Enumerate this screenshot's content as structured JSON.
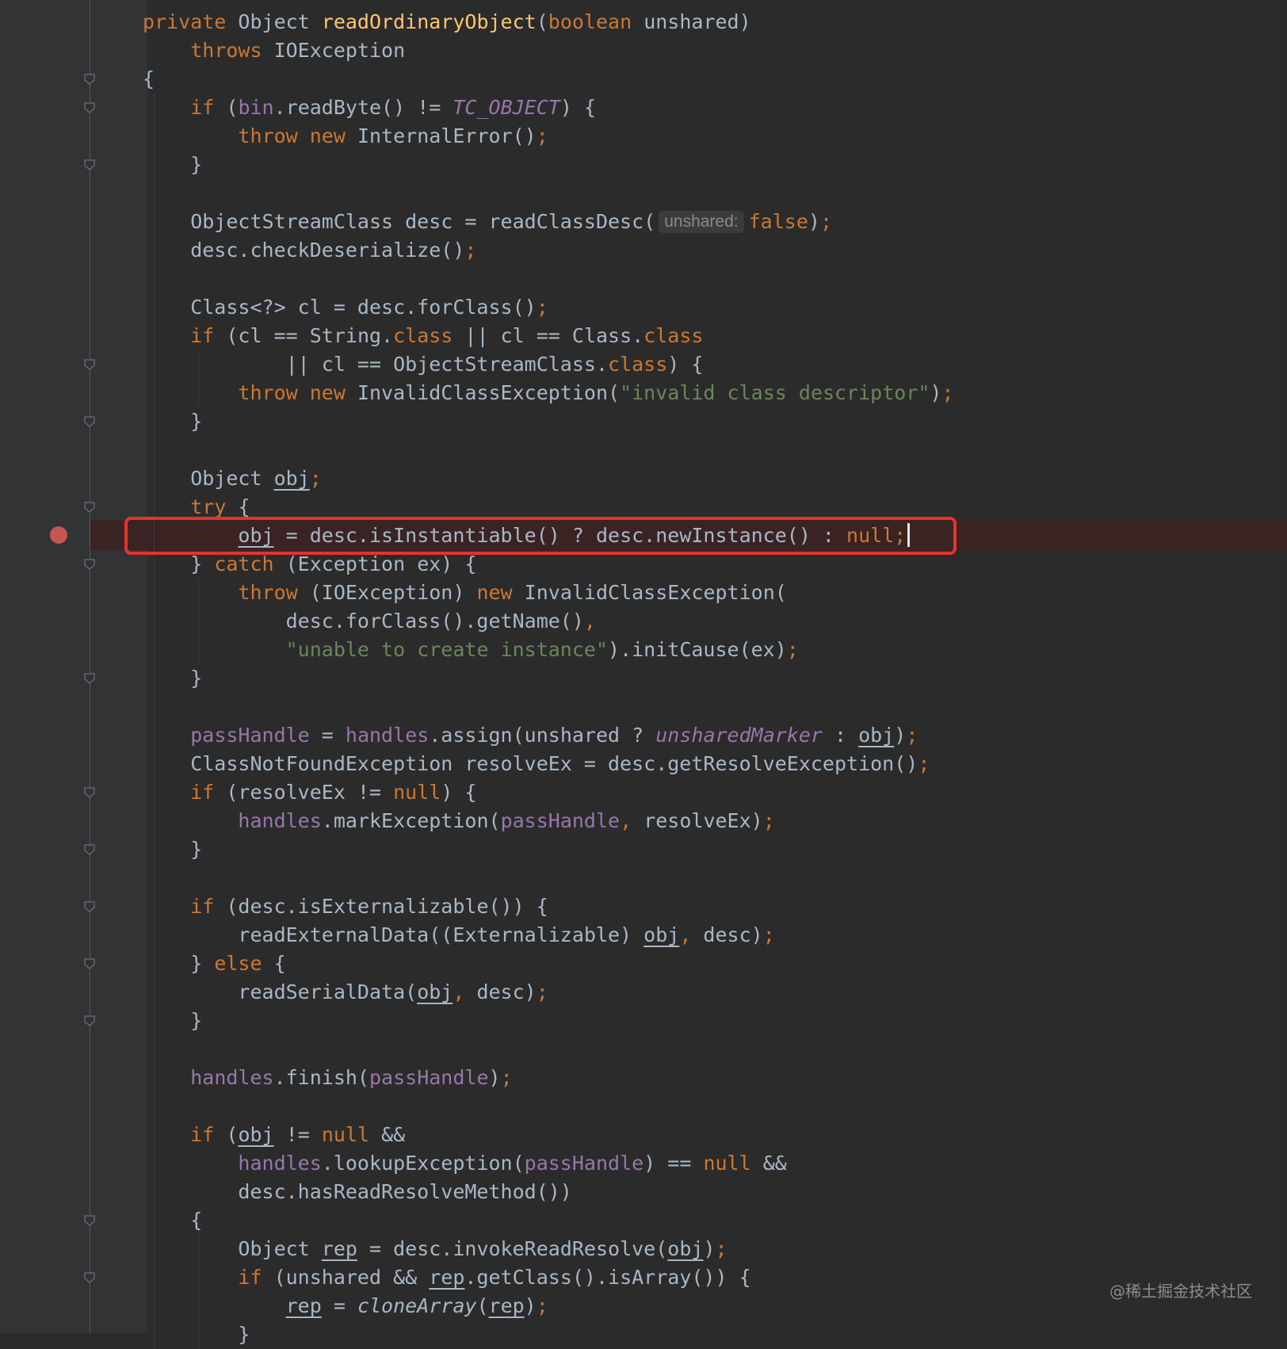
{
  "editor": {
    "language": "Java",
    "highlighted_line": 19,
    "breakpoint_line": 19,
    "lines": [
      [
        {
          "t": "private ",
          "c": "kw"
        },
        {
          "t": "Object "
        },
        {
          "t": "readOrdinaryObject",
          "c": "fn"
        },
        {
          "t": "("
        },
        {
          "t": "boolean ",
          "c": "kw"
        },
        {
          "t": "unshared)"
        }
      ],
      [
        {
          "t": "    "
        },
        {
          "t": "throws ",
          "c": "kw"
        },
        {
          "t": "IOException"
        }
      ],
      [
        {
          "t": "{"
        }
      ],
      [
        {
          "t": "    "
        },
        {
          "t": "if ",
          "c": "kw"
        },
        {
          "t": "("
        },
        {
          "t": "bin",
          "c": "fld"
        },
        {
          "t": ".readByte() != "
        },
        {
          "t": "TC_OBJECT",
          "c": "ist"
        },
        {
          "t": ") {"
        }
      ],
      [
        {
          "t": "        "
        },
        {
          "t": "throw new ",
          "c": "kw"
        },
        {
          "t": "InternalError()"
        },
        {
          "t": ";",
          "c": "kw"
        }
      ],
      [
        {
          "t": "    }"
        }
      ],
      [],
      [
        {
          "t": "    ObjectStreamClass desc = readClassDesc("
        },
        {
          "t": "unshared:",
          "c": "hint"
        },
        {
          "t": "false",
          "c": "kw"
        },
        {
          "t": ")"
        },
        {
          "t": ";",
          "c": "kw"
        }
      ],
      [
        {
          "t": "    desc.checkDeserialize()"
        },
        {
          "t": ";",
          "c": "kw"
        }
      ],
      [],
      [
        {
          "t": "    Class<?> cl = desc.forClass()"
        },
        {
          "t": ";",
          "c": "kw"
        }
      ],
      [
        {
          "t": "    "
        },
        {
          "t": "if ",
          "c": "kw"
        },
        {
          "t": "(cl == String."
        },
        {
          "t": "class ",
          "c": "kw"
        },
        {
          "t": "|| cl == Class."
        },
        {
          "t": "class",
          "c": "kw"
        }
      ],
      [
        {
          "t": "            || cl == ObjectStreamClass."
        },
        {
          "t": "class",
          "c": "kw"
        },
        {
          "t": ") {"
        }
      ],
      [
        {
          "t": "        "
        },
        {
          "t": "throw new ",
          "c": "kw"
        },
        {
          "t": "InvalidClassException("
        },
        {
          "t": "\"invalid class descriptor\"",
          "c": "str"
        },
        {
          "t": ")"
        },
        {
          "t": ";",
          "c": "kw"
        }
      ],
      [
        {
          "t": "    }"
        }
      ],
      [],
      [
        {
          "t": "    Object "
        },
        {
          "t": "obj",
          "c": "ul"
        },
        {
          "t": ";",
          "c": "kw"
        }
      ],
      [
        {
          "t": "    "
        },
        {
          "t": "try ",
          "c": "kw"
        },
        {
          "t": "{"
        }
      ],
      [
        {
          "t": "        "
        },
        {
          "t": "obj",
          "c": "ul"
        },
        {
          "t": " = desc.isInstantiable() ? desc.newInstance() : "
        },
        {
          "t": "null;",
          "c": "kw"
        },
        {
          "t": "",
          "c": "caret"
        }
      ],
      [
        {
          "t": "    } "
        },
        {
          "t": "catch ",
          "c": "kw"
        },
        {
          "t": "(Exception ex) {"
        }
      ],
      [
        {
          "t": "        "
        },
        {
          "t": "throw ",
          "c": "kw"
        },
        {
          "t": "(IOException) "
        },
        {
          "t": "new ",
          "c": "kw"
        },
        {
          "t": "InvalidClassException("
        }
      ],
      [
        {
          "t": "            desc.forClass().getName()"
        },
        {
          "t": ",",
          "c": "kw"
        }
      ],
      [
        {
          "t": "            "
        },
        {
          "t": "\"unable to create instance\"",
          "c": "str"
        },
        {
          "t": ").initCause(ex)"
        },
        {
          "t": ";",
          "c": "kw"
        }
      ],
      [
        {
          "t": "    }"
        }
      ],
      [],
      [
        {
          "t": "    "
        },
        {
          "t": "passHandle",
          "c": "fld"
        },
        {
          "t": " = "
        },
        {
          "t": "handles",
          "c": "fld"
        },
        {
          "t": ".assign(unshared ? "
        },
        {
          "t": "unsharedMarker",
          "c": "ist"
        },
        {
          "t": " : "
        },
        {
          "t": "obj",
          "c": "ul"
        },
        {
          "t": ")"
        },
        {
          "t": ";",
          "c": "kw"
        }
      ],
      [
        {
          "t": "    ClassNotFoundException resolveEx = desc.getResolveException()"
        },
        {
          "t": ";",
          "c": "kw"
        }
      ],
      [
        {
          "t": "    "
        },
        {
          "t": "if ",
          "c": "kw"
        },
        {
          "t": "(resolveEx != "
        },
        {
          "t": "null",
          "c": "kw"
        },
        {
          "t": ") {"
        }
      ],
      [
        {
          "t": "        "
        },
        {
          "t": "handles",
          "c": "fld"
        },
        {
          "t": ".markException("
        },
        {
          "t": "passHandle",
          "c": "fld"
        },
        {
          "t": ", ",
          "c": "kw"
        },
        {
          "t": "resolveEx)"
        },
        {
          "t": ";",
          "c": "kw"
        }
      ],
      [
        {
          "t": "    }"
        }
      ],
      [],
      [
        {
          "t": "    "
        },
        {
          "t": "if ",
          "c": "kw"
        },
        {
          "t": "(desc.isExternalizable()) {"
        }
      ],
      [
        {
          "t": "        readExternalData((Externalizable) "
        },
        {
          "t": "obj",
          "c": "ul"
        },
        {
          "t": ", ",
          "c": "kw"
        },
        {
          "t": "desc)"
        },
        {
          "t": ";",
          "c": "kw"
        }
      ],
      [
        {
          "t": "    } "
        },
        {
          "t": "else ",
          "c": "kw"
        },
        {
          "t": "{"
        }
      ],
      [
        {
          "t": "        readSerialData("
        },
        {
          "t": "obj",
          "c": "ul"
        },
        {
          "t": ", ",
          "c": "kw"
        },
        {
          "t": "desc)"
        },
        {
          "t": ";",
          "c": "kw"
        }
      ],
      [
        {
          "t": "    }"
        }
      ],
      [],
      [
        {
          "t": "    "
        },
        {
          "t": "handles",
          "c": "fld"
        },
        {
          "t": ".finish("
        },
        {
          "t": "passHandle",
          "c": "fld"
        },
        {
          "t": ")"
        },
        {
          "t": ";",
          "c": "kw"
        }
      ],
      [],
      [
        {
          "t": "    "
        },
        {
          "t": "if ",
          "c": "kw"
        },
        {
          "t": "("
        },
        {
          "t": "obj",
          "c": "ul"
        },
        {
          "t": " != "
        },
        {
          "t": "null ",
          "c": "kw"
        },
        {
          "t": "&&"
        }
      ],
      [
        {
          "t": "        "
        },
        {
          "t": "handles",
          "c": "fld"
        },
        {
          "t": ".lookupException("
        },
        {
          "t": "passHandle",
          "c": "fld"
        },
        {
          "t": ") == "
        },
        {
          "t": "null ",
          "c": "kw"
        },
        {
          "t": "&&"
        }
      ],
      [
        {
          "t": "        desc.hasReadResolveMethod())"
        }
      ],
      [
        {
          "t": "    {"
        }
      ],
      [
        {
          "t": "        Object "
        },
        {
          "t": "rep",
          "c": "ul"
        },
        {
          "t": " = desc.invokeReadResolve("
        },
        {
          "t": "obj",
          "c": "ul"
        },
        {
          "t": ")"
        },
        {
          "t": ";",
          "c": "kw"
        }
      ],
      [
        {
          "t": "        "
        },
        {
          "t": "if ",
          "c": "kw"
        },
        {
          "t": "(unshared && "
        },
        {
          "t": "rep",
          "c": "ul"
        },
        {
          "t": ".getClass().isArray()) {"
        }
      ],
      [
        {
          "t": "            "
        },
        {
          "t": "rep",
          "c": "ul"
        },
        {
          "t": " = "
        },
        {
          "t": "cloneArray",
          "c": "sm"
        },
        {
          "t": "("
        },
        {
          "t": "rep",
          "c": "ul"
        },
        {
          "t": ")"
        },
        {
          "t": ";",
          "c": "kw"
        }
      ],
      [
        {
          "t": "        }"
        }
      ]
    ],
    "fold_marker_lines": [
      2,
      3,
      5,
      12,
      14,
      17,
      19,
      23,
      27,
      29,
      31,
      33,
      35,
      42,
      44
    ]
  },
  "watermark": "@稀土掘金技术社区"
}
